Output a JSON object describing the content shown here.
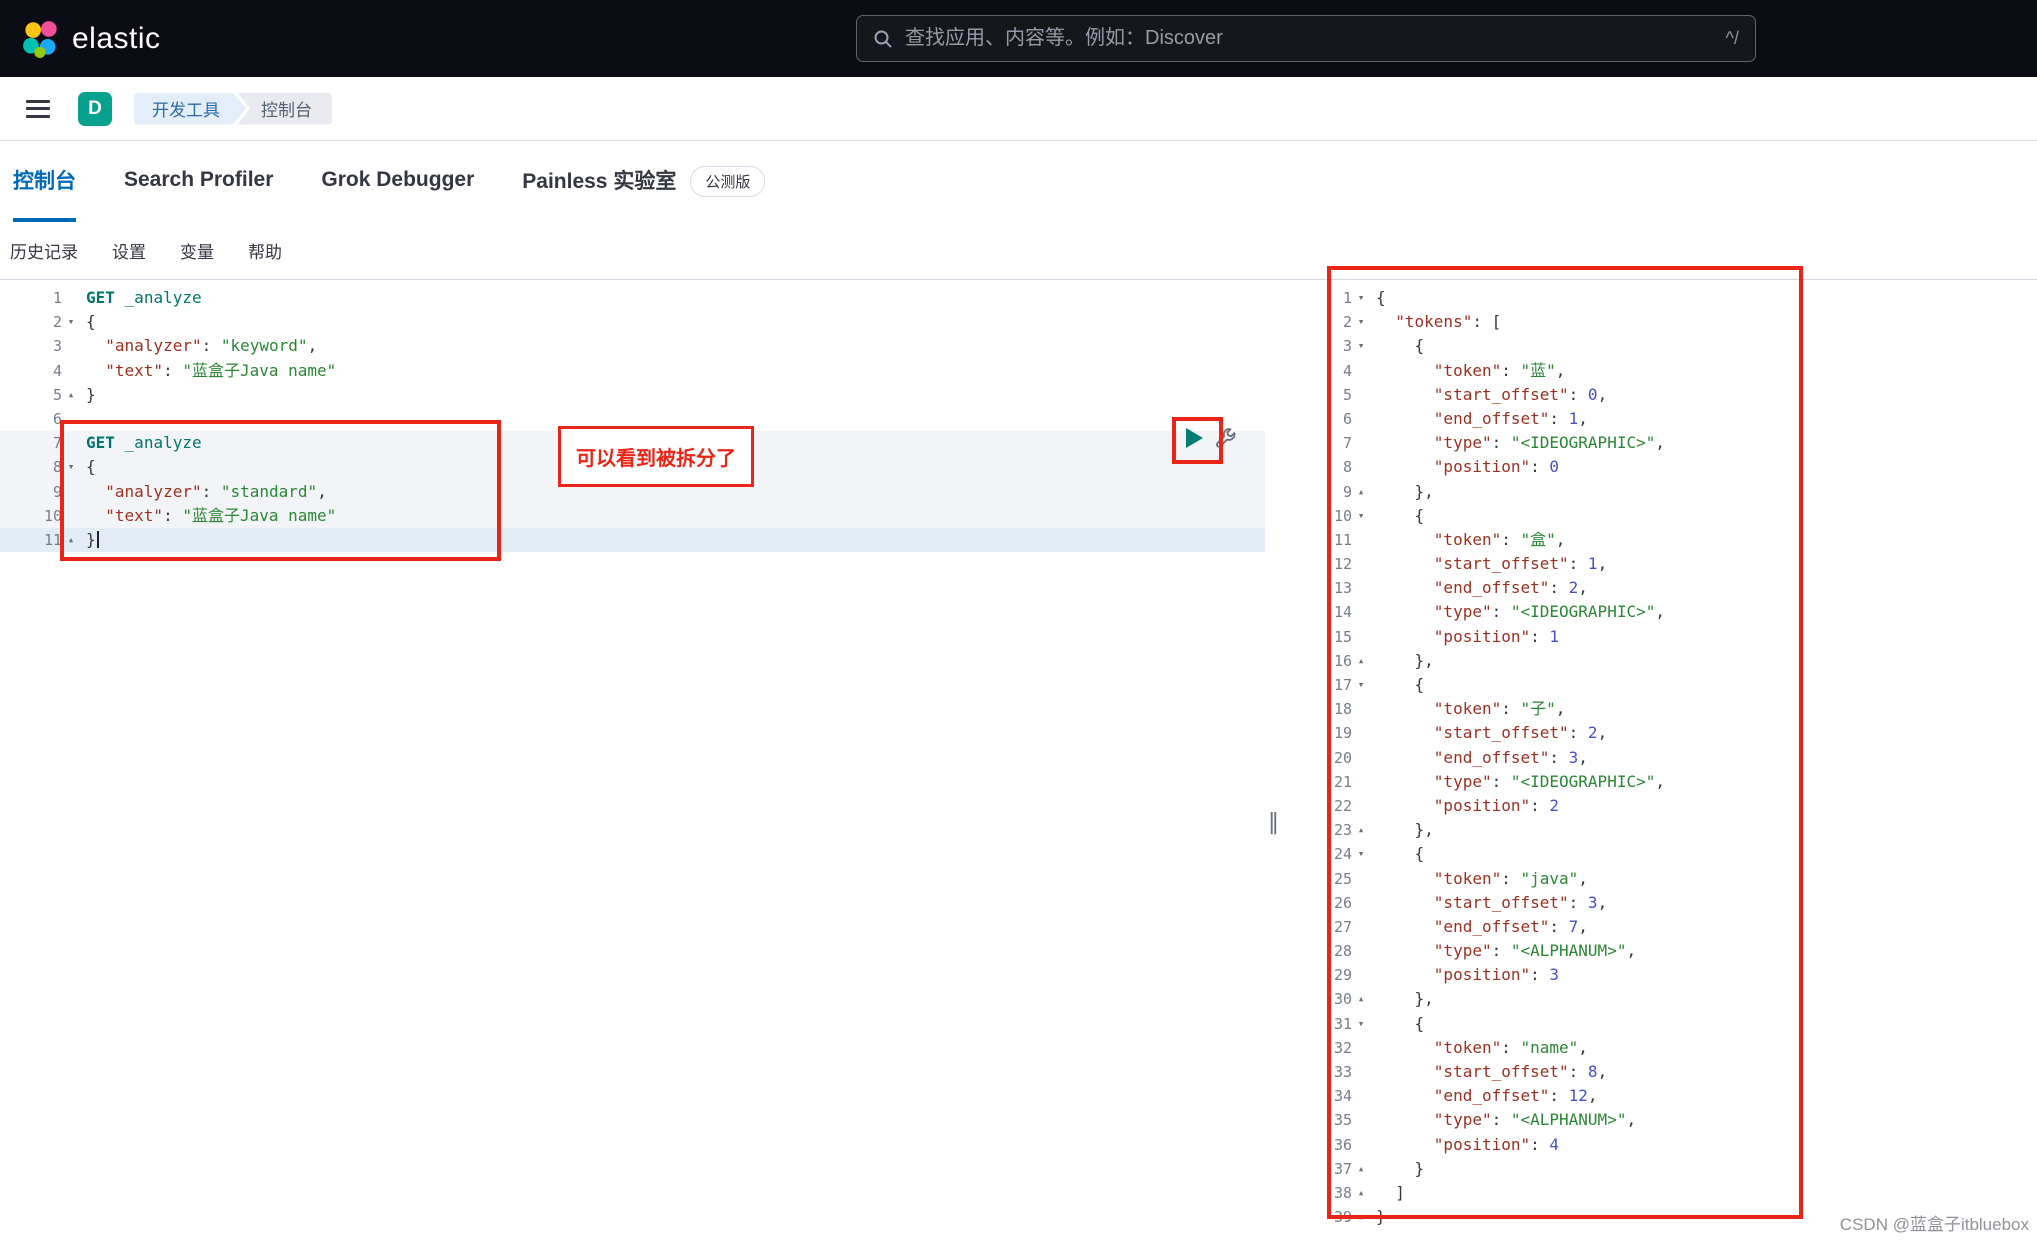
{
  "header": {
    "brand": "elastic",
    "search_placeholder": "查找应用、内容等。例如：Discover",
    "shortcut_hint": "^/"
  },
  "breadcrumbs": {
    "space_badge": "D",
    "items": [
      "开发工具",
      "控制台"
    ]
  },
  "tabs": {
    "items": [
      {
        "label": "控制台",
        "active": true
      },
      {
        "label": "Search Profiler"
      },
      {
        "label": "Grok Debugger"
      },
      {
        "label": "Painless 实验室",
        "badge": "公测版"
      }
    ]
  },
  "toolbar": {
    "items": [
      "历史记录",
      "设置",
      "变量",
      "帮助"
    ]
  },
  "editor": {
    "lines": [
      {
        "n": 1,
        "s": [
          [
            "m",
            "GET"
          ],
          [
            "p",
            " "
          ],
          [
            "u",
            "_analyze"
          ]
        ]
      },
      {
        "n": 2,
        "f": "v",
        "s": [
          [
            "p",
            "{"
          ]
        ]
      },
      {
        "n": 3,
        "s": [
          [
            "p",
            "  "
          ],
          [
            "k",
            "\"analyzer\""
          ],
          [
            "p",
            ": "
          ],
          [
            "s",
            "\"keyword\""
          ],
          [
            "p",
            ","
          ]
        ]
      },
      {
        "n": 4,
        "s": [
          [
            "p",
            "  "
          ],
          [
            "k",
            "\"text\""
          ],
          [
            "p",
            ": "
          ],
          [
            "s",
            "\"蓝盒子Java name\""
          ]
        ]
      },
      {
        "n": 5,
        "f": "^",
        "s": [
          [
            "p",
            "}"
          ]
        ]
      },
      {
        "n": 6,
        "s": []
      },
      {
        "n": 7,
        "a": true,
        "s": [
          [
            "m",
            "GET"
          ],
          [
            "p",
            " "
          ],
          [
            "u",
            "_analyze"
          ]
        ]
      },
      {
        "n": 8,
        "f": "v",
        "a": true,
        "s": [
          [
            "p",
            "{"
          ]
        ]
      },
      {
        "n": 9,
        "a": true,
        "s": [
          [
            "p",
            "  "
          ],
          [
            "k",
            "\"analyzer\""
          ],
          [
            "p",
            ": "
          ],
          [
            "s",
            "\"standard\""
          ],
          [
            "p",
            ","
          ]
        ]
      },
      {
        "n": 10,
        "a": true,
        "s": [
          [
            "p",
            "  "
          ],
          [
            "k",
            "\"text\""
          ],
          [
            "p",
            ": "
          ],
          [
            "s",
            "\"蓝盒子Java name\""
          ]
        ]
      },
      {
        "n": 11,
        "f": "^",
        "cur": true,
        "cursor": true,
        "s": [
          [
            "p",
            "}"
          ]
        ]
      }
    ]
  },
  "response": {
    "lines": [
      {
        "n": 1,
        "f": "v",
        "s": [
          [
            "p",
            "{"
          ]
        ]
      },
      {
        "n": 2,
        "f": "v",
        "s": [
          [
            "p",
            "  "
          ],
          [
            "k",
            "\"tokens\""
          ],
          [
            "p",
            ": ["
          ]
        ]
      },
      {
        "n": 3,
        "f": "v",
        "s": [
          [
            "p",
            "    {"
          ]
        ]
      },
      {
        "n": 4,
        "s": [
          [
            "p",
            "      "
          ],
          [
            "k",
            "\"token\""
          ],
          [
            "p",
            ": "
          ],
          [
            "s",
            "\"蓝\""
          ],
          [
            "p",
            ","
          ]
        ]
      },
      {
        "n": 5,
        "s": [
          [
            "p",
            "      "
          ],
          [
            "k",
            "\"start_offset\""
          ],
          [
            "p",
            ": "
          ],
          [
            "n",
            "0"
          ],
          [
            "p",
            ","
          ]
        ]
      },
      {
        "n": 6,
        "s": [
          [
            "p",
            "      "
          ],
          [
            "k",
            "\"end_offset\""
          ],
          [
            "p",
            ": "
          ],
          [
            "n",
            "1"
          ],
          [
            "p",
            ","
          ]
        ]
      },
      {
        "n": 7,
        "s": [
          [
            "p",
            "      "
          ],
          [
            "k",
            "\"type\""
          ],
          [
            "p",
            ": "
          ],
          [
            "s",
            "\"<IDEOGRAPHIC>\""
          ],
          [
            "p",
            ","
          ]
        ]
      },
      {
        "n": 8,
        "s": [
          [
            "p",
            "      "
          ],
          [
            "k",
            "\"position\""
          ],
          [
            "p",
            ": "
          ],
          [
            "n",
            "0"
          ]
        ]
      },
      {
        "n": 9,
        "f": "^",
        "s": [
          [
            "p",
            "    },"
          ]
        ]
      },
      {
        "n": 10,
        "f": "v",
        "s": [
          [
            "p",
            "    {"
          ]
        ]
      },
      {
        "n": 11,
        "s": [
          [
            "p",
            "      "
          ],
          [
            "k",
            "\"token\""
          ],
          [
            "p",
            ": "
          ],
          [
            "s",
            "\"盒\""
          ],
          [
            "p",
            ","
          ]
        ]
      },
      {
        "n": 12,
        "s": [
          [
            "p",
            "      "
          ],
          [
            "k",
            "\"start_offset\""
          ],
          [
            "p",
            ": "
          ],
          [
            "n",
            "1"
          ],
          [
            "p",
            ","
          ]
        ]
      },
      {
        "n": 13,
        "s": [
          [
            "p",
            "      "
          ],
          [
            "k",
            "\"end_offset\""
          ],
          [
            "p",
            ": "
          ],
          [
            "n",
            "2"
          ],
          [
            "p",
            ","
          ]
        ]
      },
      {
        "n": 14,
        "s": [
          [
            "p",
            "      "
          ],
          [
            "k",
            "\"type\""
          ],
          [
            "p",
            ": "
          ],
          [
            "s",
            "\"<IDEOGRAPHIC>\""
          ],
          [
            "p",
            ","
          ]
        ]
      },
      {
        "n": 15,
        "s": [
          [
            "p",
            "      "
          ],
          [
            "k",
            "\"position\""
          ],
          [
            "p",
            ": "
          ],
          [
            "n",
            "1"
          ]
        ]
      },
      {
        "n": 16,
        "f": "^",
        "s": [
          [
            "p",
            "    },"
          ]
        ]
      },
      {
        "n": 17,
        "f": "v",
        "s": [
          [
            "p",
            "    {"
          ]
        ]
      },
      {
        "n": 18,
        "s": [
          [
            "p",
            "      "
          ],
          [
            "k",
            "\"token\""
          ],
          [
            "p",
            ": "
          ],
          [
            "s",
            "\"子\""
          ],
          [
            "p",
            ","
          ]
        ]
      },
      {
        "n": 19,
        "s": [
          [
            "p",
            "      "
          ],
          [
            "k",
            "\"start_offset\""
          ],
          [
            "p",
            ": "
          ],
          [
            "n",
            "2"
          ],
          [
            "p",
            ","
          ]
        ]
      },
      {
        "n": 20,
        "s": [
          [
            "p",
            "      "
          ],
          [
            "k",
            "\"end_offset\""
          ],
          [
            "p",
            ": "
          ],
          [
            "n",
            "3"
          ],
          [
            "p",
            ","
          ]
        ]
      },
      {
        "n": 21,
        "s": [
          [
            "p",
            "      "
          ],
          [
            "k",
            "\"type\""
          ],
          [
            "p",
            ": "
          ],
          [
            "s",
            "\"<IDEOGRAPHIC>\""
          ],
          [
            "p",
            ","
          ]
        ]
      },
      {
        "n": 22,
        "s": [
          [
            "p",
            "      "
          ],
          [
            "k",
            "\"position\""
          ],
          [
            "p",
            ": "
          ],
          [
            "n",
            "2"
          ]
        ]
      },
      {
        "n": 23,
        "f": "^",
        "s": [
          [
            "p",
            "    },"
          ]
        ]
      },
      {
        "n": 24,
        "f": "v",
        "s": [
          [
            "p",
            "    {"
          ]
        ]
      },
      {
        "n": 25,
        "s": [
          [
            "p",
            "      "
          ],
          [
            "k",
            "\"token\""
          ],
          [
            "p",
            ": "
          ],
          [
            "s",
            "\"java\""
          ],
          [
            "p",
            ","
          ]
        ]
      },
      {
        "n": 26,
        "s": [
          [
            "p",
            "      "
          ],
          [
            "k",
            "\"start_offset\""
          ],
          [
            "p",
            ": "
          ],
          [
            "n",
            "3"
          ],
          [
            "p",
            ","
          ]
        ]
      },
      {
        "n": 27,
        "s": [
          [
            "p",
            "      "
          ],
          [
            "k",
            "\"end_offset\""
          ],
          [
            "p",
            ": "
          ],
          [
            "n",
            "7"
          ],
          [
            "p",
            ","
          ]
        ]
      },
      {
        "n": 28,
        "s": [
          [
            "p",
            "      "
          ],
          [
            "k",
            "\"type\""
          ],
          [
            "p",
            ": "
          ],
          [
            "s",
            "\"<ALPHANUM>\""
          ],
          [
            "p",
            ","
          ]
        ]
      },
      {
        "n": 29,
        "s": [
          [
            "p",
            "      "
          ],
          [
            "k",
            "\"position\""
          ],
          [
            "p",
            ": "
          ],
          [
            "n",
            "3"
          ]
        ]
      },
      {
        "n": 30,
        "f": "^",
        "s": [
          [
            "p",
            "    },"
          ]
        ]
      },
      {
        "n": 31,
        "f": "v",
        "s": [
          [
            "p",
            "    {"
          ]
        ]
      },
      {
        "n": 32,
        "s": [
          [
            "p",
            "      "
          ],
          [
            "k",
            "\"token\""
          ],
          [
            "p",
            ": "
          ],
          [
            "s",
            "\"name\""
          ],
          [
            "p",
            ","
          ]
        ]
      },
      {
        "n": 33,
        "s": [
          [
            "p",
            "      "
          ],
          [
            "k",
            "\"start_offset\""
          ],
          [
            "p",
            ": "
          ],
          [
            "n",
            "8"
          ],
          [
            "p",
            ","
          ]
        ]
      },
      {
        "n": 34,
        "s": [
          [
            "p",
            "      "
          ],
          [
            "k",
            "\"end_offset\""
          ],
          [
            "p",
            ": "
          ],
          [
            "n",
            "12"
          ],
          [
            "p",
            ","
          ]
        ]
      },
      {
        "n": 35,
        "s": [
          [
            "p",
            "      "
          ],
          [
            "k",
            "\"type\""
          ],
          [
            "p",
            ": "
          ],
          [
            "s",
            "\"<ALPHANUM>\""
          ],
          [
            "p",
            ","
          ]
        ]
      },
      {
        "n": 36,
        "s": [
          [
            "p",
            "      "
          ],
          [
            "k",
            "\"position\""
          ],
          [
            "p",
            ": "
          ],
          [
            "n",
            "4"
          ]
        ]
      },
      {
        "n": 37,
        "f": "^",
        "s": [
          [
            "p",
            "    }"
          ]
        ]
      },
      {
        "n": 38,
        "f": "^",
        "s": [
          [
            "p",
            "  ]"
          ]
        ]
      },
      {
        "n": 39,
        "f": "^",
        "s": [
          [
            "p",
            "}"
          ]
        ]
      }
    ]
  },
  "annotations": {
    "split_note": "可以看到被拆分了"
  },
  "footer": {
    "watermark": "CSDN @蓝盒子itbluebox"
  },
  "colors": {
    "accent_blue": "#006bb4",
    "method_teal": "#00756c",
    "key_maroon": "#9b3022",
    "string_green": "#2a8735",
    "number_blue": "#4650c8",
    "annotation_red": "#ea2518",
    "space_badge_teal": "#07a18f"
  }
}
